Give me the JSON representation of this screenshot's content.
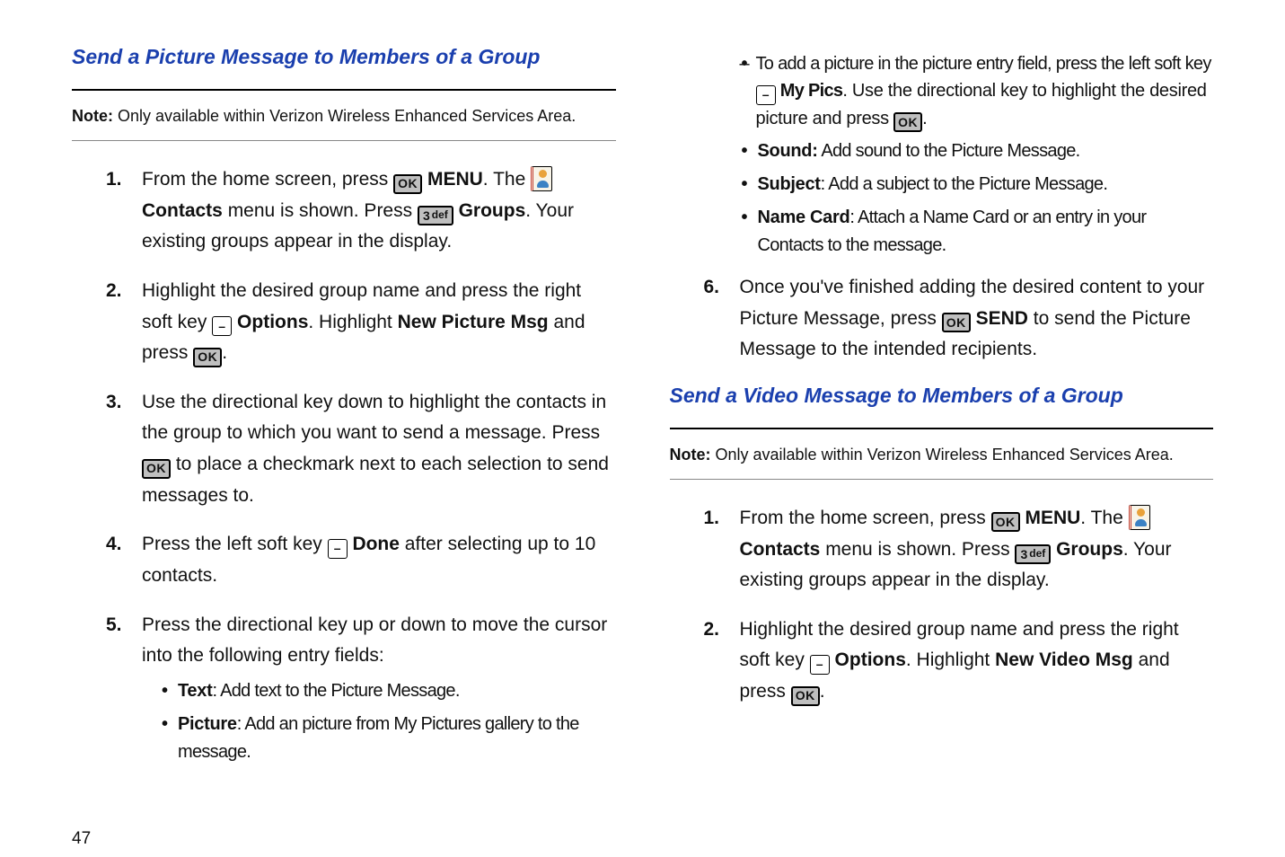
{
  "page_number": "47",
  "left": {
    "title": "Send a Picture Message to Members of a Group",
    "note_label": "Note:",
    "note_text": " Only available within Verizon Wireless Enhanced Services Area.",
    "s1_a": "From the home screen, press ",
    "s1_menu": "MENU",
    "s1_b": ". The ",
    "s1_contacts": "Contacts",
    "s1_c": " menu is shown. Press ",
    "s1_groups": "Groups",
    "s1_d": ". Your existing groups appear in the display.",
    "s2_a": "Highlight the desired group name and press the right soft key ",
    "s2_options": "Options",
    "s2_b": ". Highlight ",
    "s2_newmsg": "New Picture Msg",
    "s2_c": " and press ",
    "s2_d": ".",
    "s3_a": "Use the directional key down to highlight the contacts in the group to which you want to send a message. Press ",
    "s3_b": " to place a checkmark next to each selection to send messages to.",
    "s4_a": "Press the left soft key ",
    "s4_done": "Done",
    "s4_b": " after selecting up to 10 contacts.",
    "s5": "Press the directional key up or down to move the cursor into the following entry fields:",
    "bul_text_label": "Text",
    "bul_text": ": Add text to the Picture Message.",
    "bul_pic_label": "Picture",
    "bul_pic": ": Add an picture from My Pictures gallery to the message."
  },
  "right": {
    "sub_a": "To add a picture in the picture entry field, press the left soft key ",
    "sub_mypics": "My Pics",
    "sub_b": ". Use the directional key to highlight the desired picture and press ",
    "sub_c": ".",
    "bul_sound_label": "Sound:",
    "bul_sound": " Add sound to the Picture Message.",
    "bul_subj_label": "Subject",
    "bul_subj": ": Add a subject to the Picture Message.",
    "bul_name_label": "Name Card",
    "bul_name": ": Attach a Name Card or an entry in your Contacts to the message.",
    "s6_a": "Once you've finished adding the desired content to your Picture Message, press ",
    "s6_send": "SEND",
    "s6_b": " to send the Picture Message to the intended recipients.",
    "title2": "Send a Video Message to Members of a Group",
    "note2_label": "Note:",
    "note2_text": " Only available within Verizon Wireless Enhanced Services Area.",
    "v1_a": "From the home screen, press ",
    "v1_menu": "MENU",
    "v1_b": ". The ",
    "v1_contacts": "Contacts",
    "v1_c": " menu is shown. Press ",
    "v1_groups": "Groups",
    "v1_d": ". Your existing groups appear in the display.",
    "v2_a": "Highlight the desired group name and press the right soft key ",
    "v2_options": "Options",
    "v2_b": ". Highlight ",
    "v2_newmsg": "New Video Msg",
    "v2_c": " and press ",
    "v2_d": "."
  },
  "keys": {
    "ok": "OK",
    "dash": "–",
    "threedef_3": "3",
    "threedef_def": "def"
  }
}
